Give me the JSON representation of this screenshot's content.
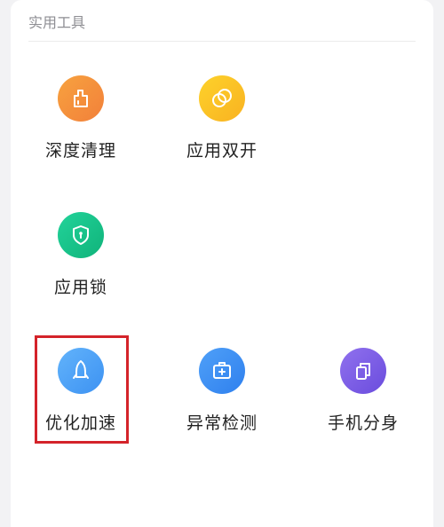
{
  "section": {
    "title": "实用工具"
  },
  "tools": [
    {
      "label": "深度清理",
      "icon": "broom-icon",
      "color": "#f5933a"
    },
    {
      "label": "应用双开",
      "icon": "dual-circles-icon",
      "color": "#fbc02d"
    },
    {
      "label": "应用锁",
      "icon": "shield-lock-icon",
      "color": "#16c28a"
    },
    {
      "label": "优化加速",
      "icon": "rocket-icon",
      "color": "#4fa3f7"
    },
    {
      "label": "异常检测",
      "icon": "medical-kit-icon",
      "color": "#3d8ef5"
    },
    {
      "label": "手机分身",
      "icon": "clone-icon",
      "color": "#7d5ce6"
    }
  ],
  "highlight_color": "#d4232a"
}
